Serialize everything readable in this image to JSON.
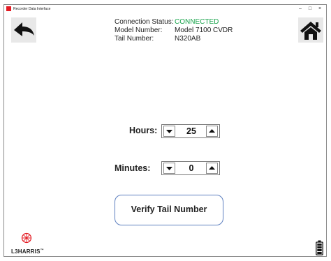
{
  "window": {
    "title": "Recorder Data Interface",
    "controls": {
      "minimize": "–",
      "maximize": "□",
      "close": "×"
    }
  },
  "header": {
    "back_icon": "back-arrow-icon",
    "home_icon": "home-icon",
    "connection_status_label": "Connection Status:",
    "connection_status_value": "CONNECTED",
    "model_number_label": "Model Number:",
    "model_number_value": "Model 7100 CVDR",
    "tail_number_label": "Tail Number:",
    "tail_number_value": "N320AB"
  },
  "form": {
    "hours_label": "Hours:",
    "hours_value": "25",
    "minutes_label": "Minutes:",
    "minutes_value": "0",
    "verify_button": "Verify Tail Number"
  },
  "footer": {
    "logo_text": "L3HARRIS",
    "trademark": "™",
    "battery_icon": "battery-icon"
  },
  "colors": {
    "connected": "#17a34a",
    "brand_red": "#e31b23",
    "button_border": "#5d7fbf"
  }
}
